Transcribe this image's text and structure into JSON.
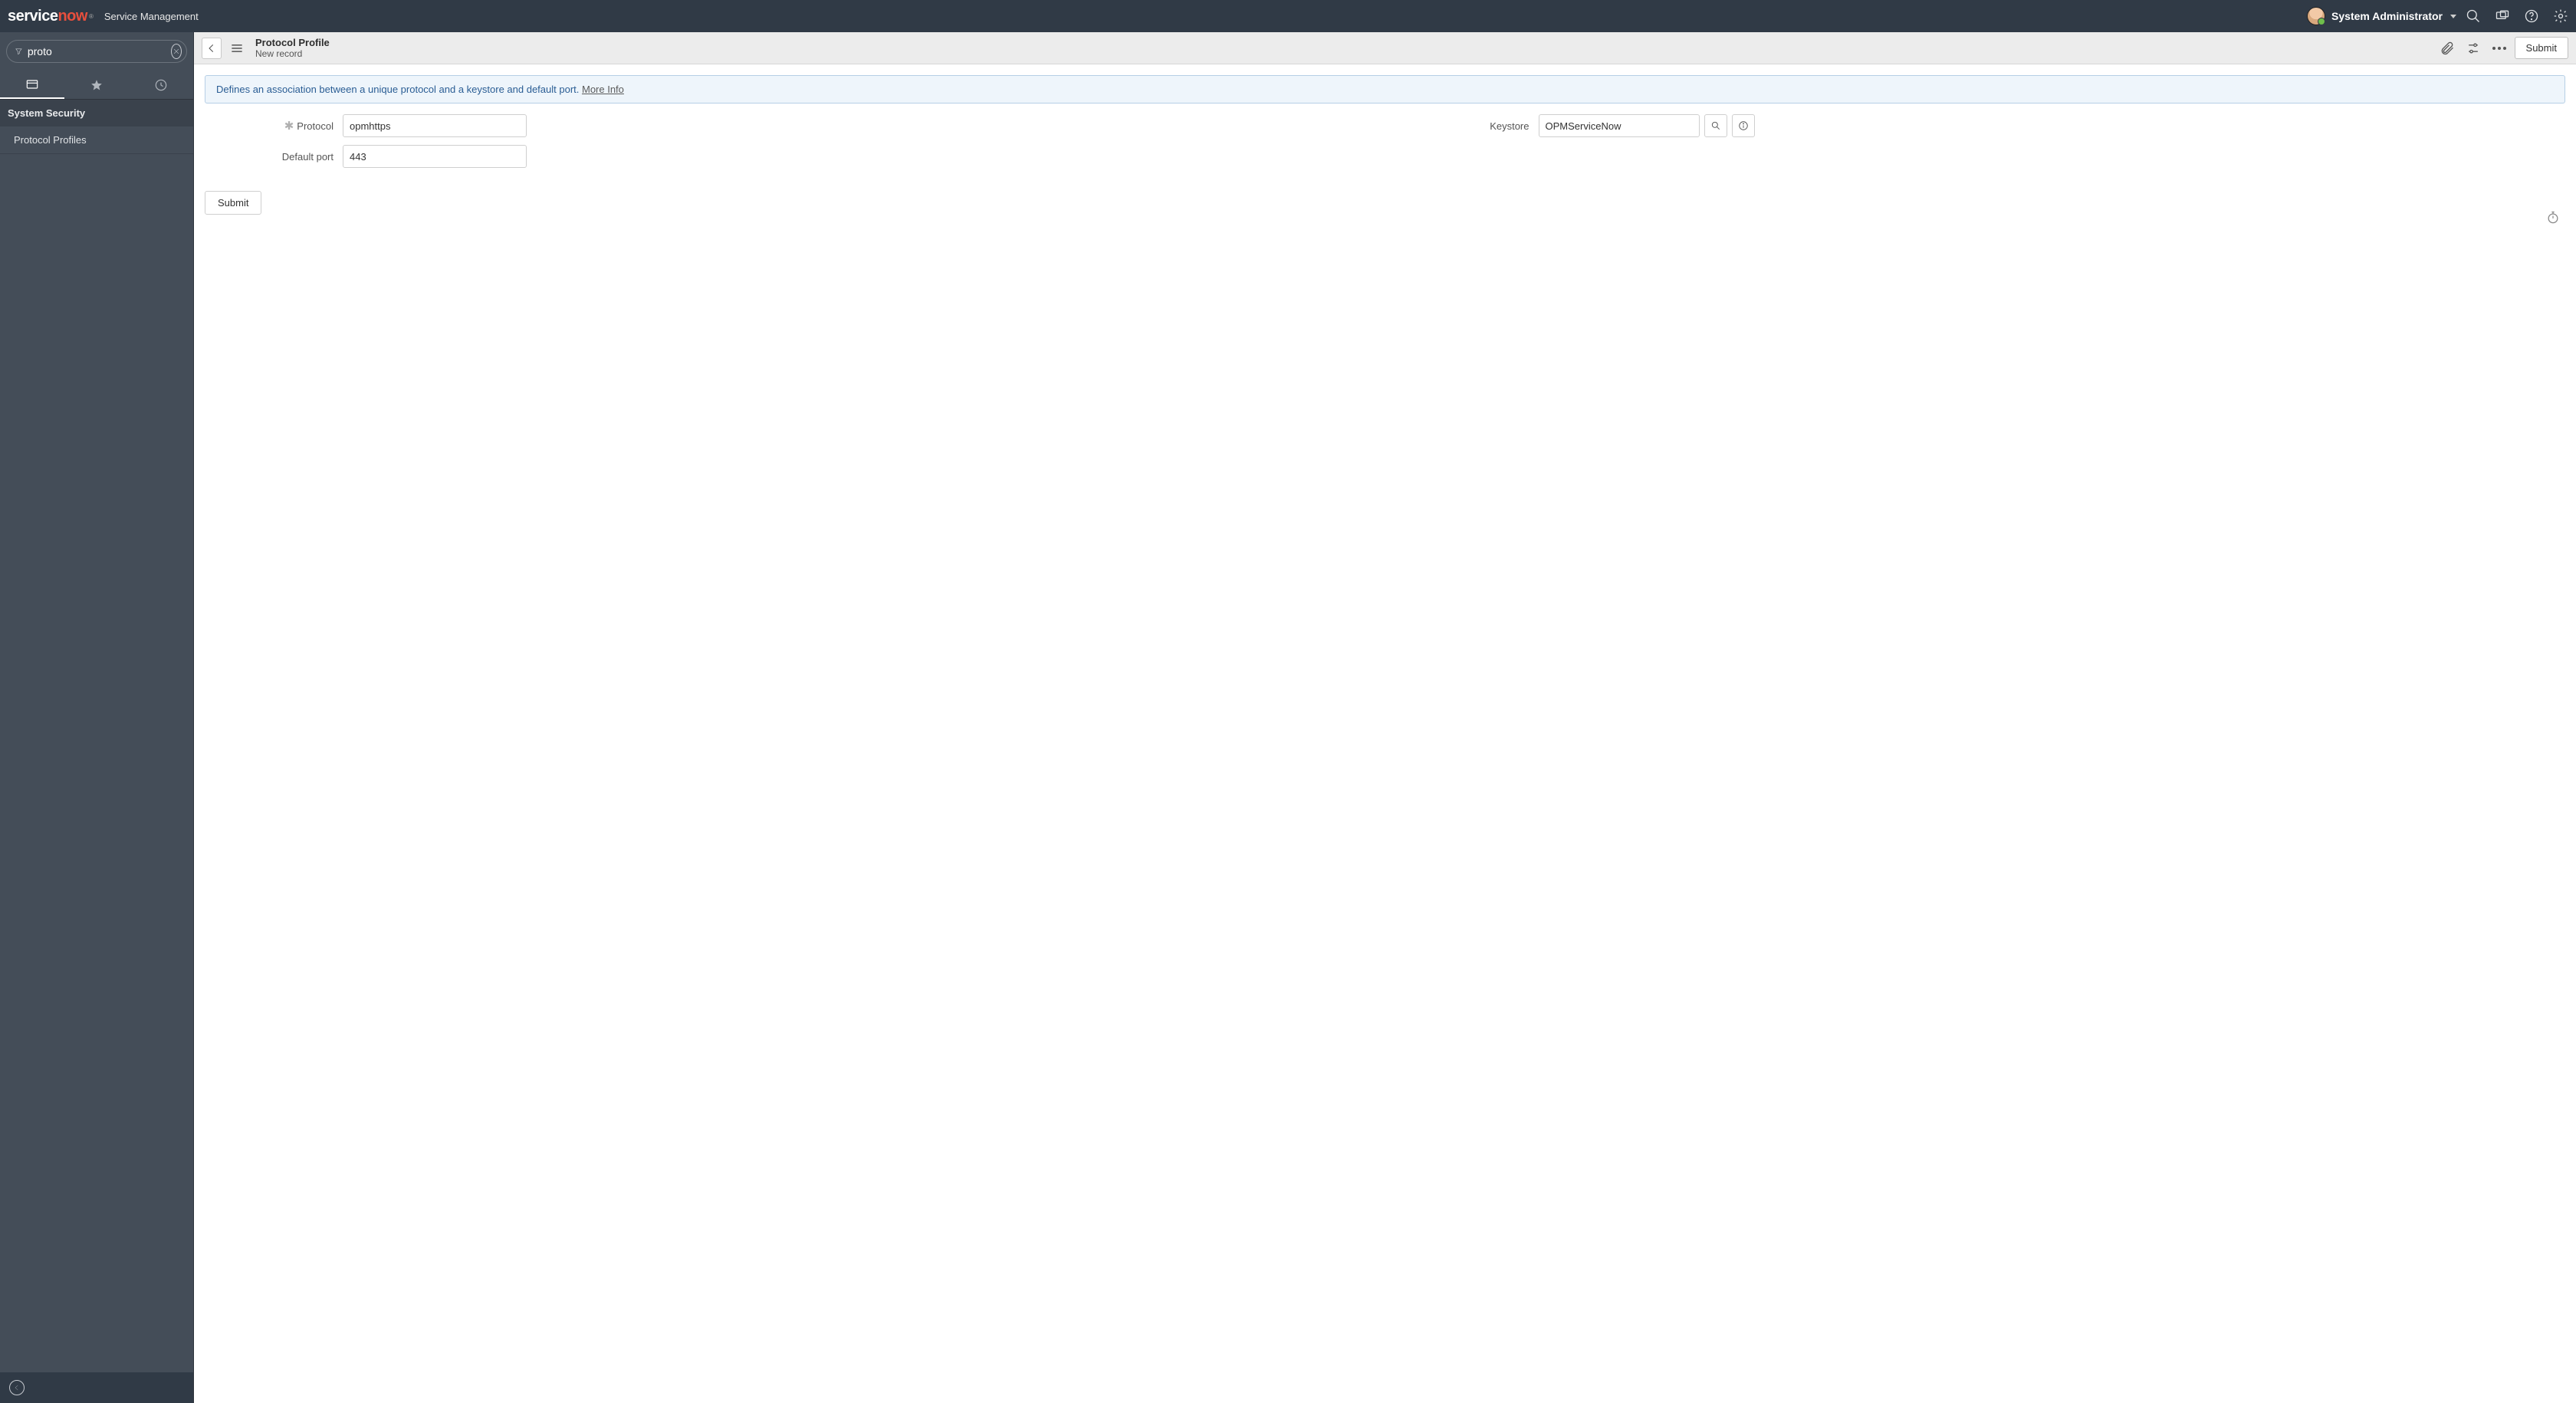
{
  "banner": {
    "logo_left": "service",
    "logo_right": "now",
    "product": "Service Management",
    "user_name": "System Administrator"
  },
  "nav": {
    "filter_value": "proto",
    "section": "System Security",
    "item": "Protocol Profiles"
  },
  "header": {
    "title": "Protocol Profile",
    "subtitle": "New record",
    "submit": "Submit"
  },
  "info": {
    "text": "Defines an association between a unique protocol and a keystore and default port. ",
    "link": "More Info"
  },
  "form": {
    "protocol_label": "Protocol",
    "protocol_value": "opmhttps",
    "port_label": "Default port",
    "port_value": "443",
    "keystore_label": "Keystore",
    "keystore_value": "OPMServiceNow"
  },
  "bottom": {
    "submit": "Submit"
  }
}
